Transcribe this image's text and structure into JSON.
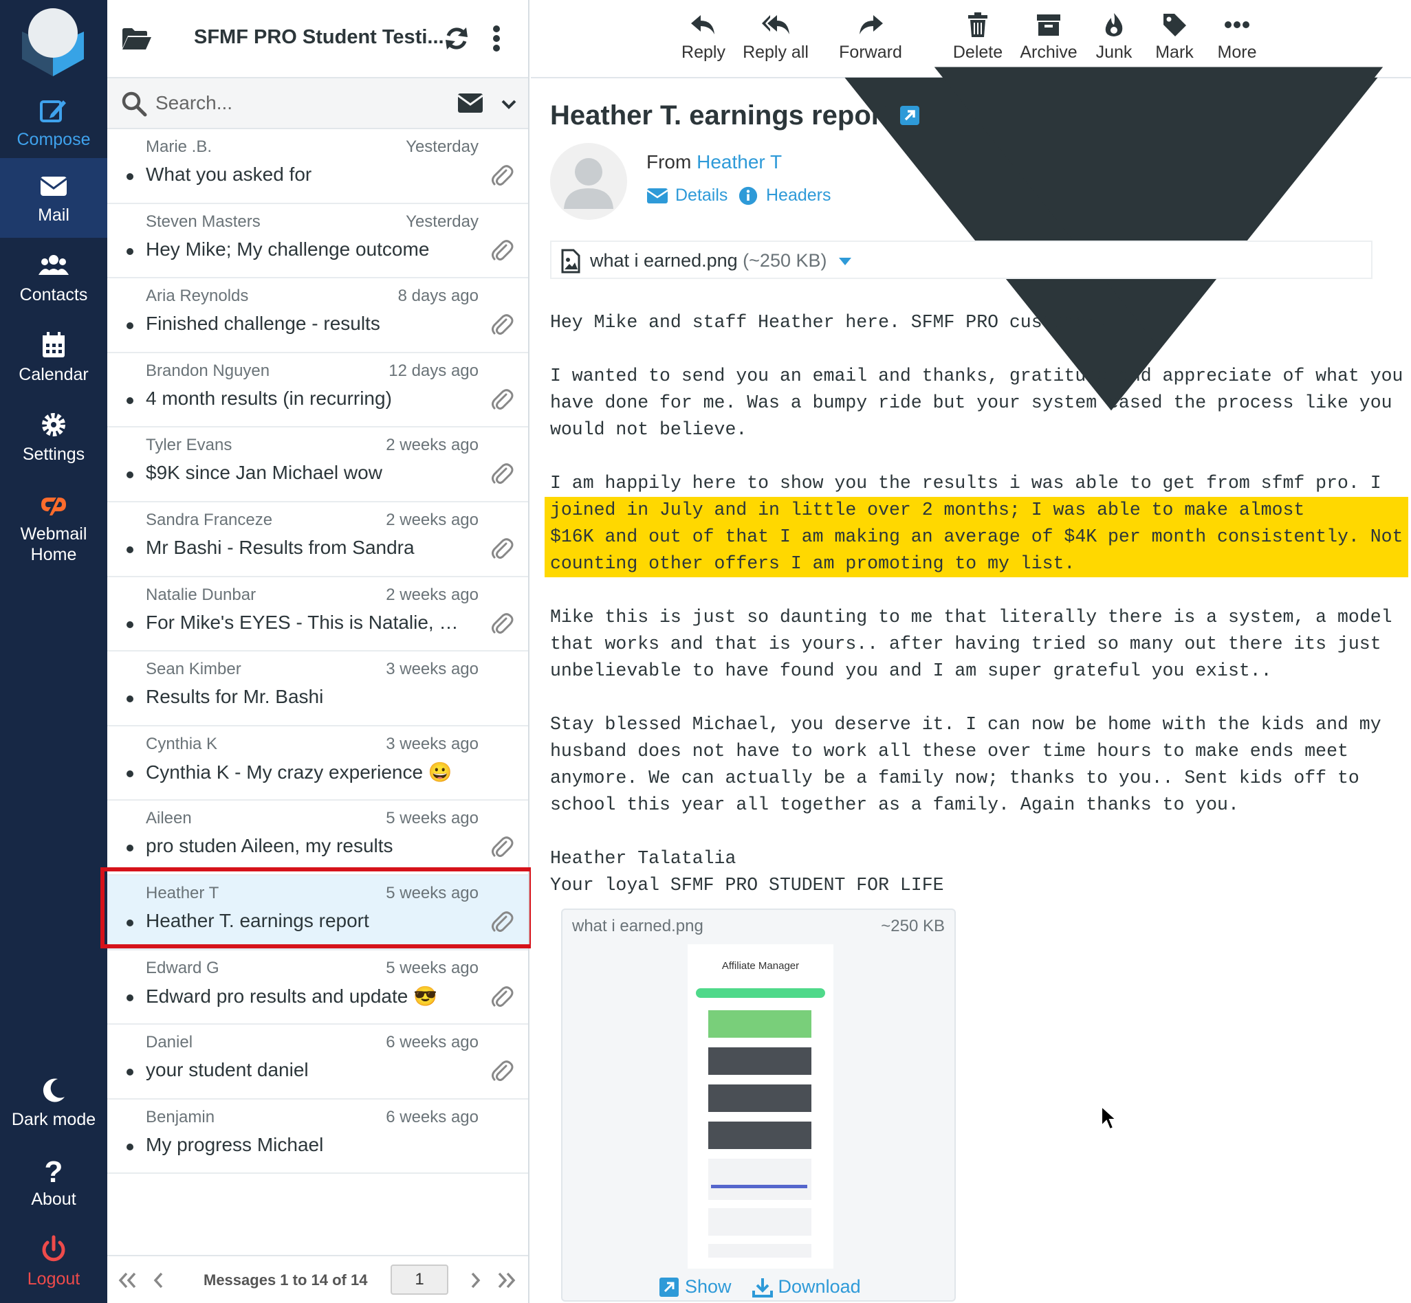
{
  "nav": {
    "compose": "Compose",
    "mail": "Mail",
    "contacts": "Contacts",
    "calendar": "Calendar",
    "settings": "Settings",
    "webmail_home": "Webmail Home",
    "dark_mode": "Dark mode",
    "about": "About",
    "logout": "Logout"
  },
  "folder": {
    "title": "SFMF PRO Student Testi..."
  },
  "search": {
    "placeholder": "Search..."
  },
  "messages": [
    {
      "from": "Marie .B.",
      "date": "Yesterday",
      "subject": "What you asked for",
      "attachment": true
    },
    {
      "from": "Steven Masters",
      "date": "Yesterday",
      "subject": "Hey Mike; My challenge outcome",
      "attachment": true
    },
    {
      "from": "Aria Reynolds",
      "date": "8 days ago",
      "subject": "Finished challenge - results",
      "attachment": true
    },
    {
      "from": "Brandon Nguyen",
      "date": "12 days ago",
      "subject": "4 month results (in recurring)",
      "attachment": true
    },
    {
      "from": "Tyler Evans",
      "date": "2 weeks ago",
      "subject": "$9K since Jan Michael wow",
      "attachment": true
    },
    {
      "from": "Sandra Franceze",
      "date": "2 weeks ago",
      "subject": "Mr Bashi - Results from Sandra",
      "attachment": true
    },
    {
      "from": "Natalie Dunbar",
      "date": "2 weeks ago",
      "subject": "For Mike's EYES - This is Natalie, My ...",
      "attachment": true
    },
    {
      "from": "Sean Kimber",
      "date": "3 weeks ago",
      "subject": "Results for Mr. Bashi",
      "attachment": false
    },
    {
      "from": "Cynthia K",
      "date": "3 weeks ago",
      "subject": "Cynthia K - My crazy experience 😀",
      "attachment": false
    },
    {
      "from": "Aileen",
      "date": "5 weeks ago",
      "subject": "pro studen Aileen, my results",
      "attachment": true
    },
    {
      "from": "Heather T",
      "date": "5 weeks ago",
      "subject": "Heather T. earnings report",
      "attachment": true,
      "selected": true
    },
    {
      "from": "Edward G",
      "date": "5 weeks ago",
      "subject": "Edward pro results and update 😎",
      "attachment": true
    },
    {
      "from": "Daniel",
      "date": "6 weeks ago",
      "subject": "your student daniel",
      "attachment": true
    },
    {
      "from": "Benjamin",
      "date": "6 weeks ago",
      "subject": "My progress Michael",
      "attachment": false
    }
  ],
  "pager": {
    "count": "Messages 1 to 14 of 14",
    "page": "1"
  },
  "toolbar": {
    "reply": "Reply",
    "reply_all": "Reply all",
    "forward": "Forward",
    "delete": "Delete",
    "archive": "Archive",
    "junk": "Junk",
    "mark": "Mark",
    "more": "More"
  },
  "email": {
    "subject": "Heather T. earnings report",
    "from_label": "From",
    "from_name": "Heather T",
    "details": "Details",
    "headers": "Headers",
    "attachment_name": "what i earned.png",
    "attachment_size": "(~250 KB)",
    "body_p1": "Hey Mike and staff Heather here. SFMF PRO customer.",
    "body_p2": "I wanted to send you an email and thanks, gratitude and appreciate of what you\nhave done for me. Was a bumpy ride but your system eased the process like you\nwould not believe.",
    "body_p3a": "I am happily here to show you the results i was able to get from sfmf pro. I",
    "body_p3b": "joined in July and in little over 2 months; I was able to make almost\n$16K and out of that I am making an average of $4K per month consistently. Not\ncounting other offers I am promoting to my list. ",
    "body_p4": "Mike this is just so daunting to me that literally there is a system, a model\nthat works and that is yours.. after having tried so many out there its just\nunbelievable to have found you and I am super grateful you exist..",
    "body_p5": "Stay blessed Michael, you deserve it. I can now be home with the kids and my\nhusband does not have to work all these over time hours to make ends meet\nanymore. We can actually be a family now; thanks to you.. Sent kids off to\nschool this year all together as a family. Again thanks to you.",
    "body_sig": "Heather Talatalia\nYour loyal SFMF PRO STUDENT FOR LIFE"
  },
  "preview": {
    "name": "what i earned.png",
    "size": "~250 KB",
    "show": "Show",
    "download": "Download",
    "thumb_title": "Affiliate Manager"
  },
  "colors": {
    "nav_bg": "#172845",
    "accent": "#2e9ad8",
    "highlight": "#ffd800",
    "selection_box": "#d6121a"
  }
}
